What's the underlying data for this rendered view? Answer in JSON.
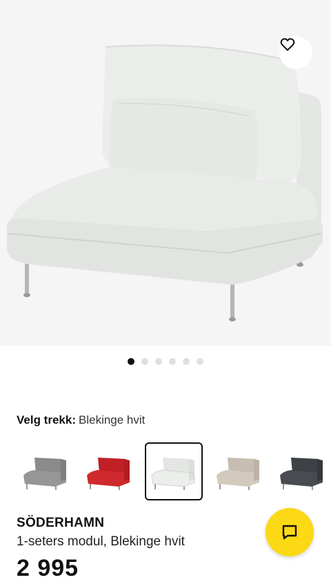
{
  "product_image": {
    "favorite_icon": "heart-outline-icon",
    "carousel_dots": [
      true,
      false,
      false,
      false,
      false,
      false
    ]
  },
  "cover": {
    "label": "Velg trekk:",
    "value": "Blekinge hvit",
    "options": [
      {
        "color": "#8f8f8f",
        "selected": false
      },
      {
        "color": "#c8262a",
        "selected": false
      },
      {
        "color": "#e9ebe9",
        "selected": true
      },
      {
        "color": "#cfc6b9",
        "selected": false
      },
      {
        "color": "#44474b",
        "selected": false
      }
    ]
  },
  "product": {
    "name": "SÖDERHAMN",
    "description": "1-seters modul, Blekinge hvit",
    "price": "2 995"
  },
  "actions": {
    "chat_icon": "chat-icon",
    "accent_color": "#fbd914"
  }
}
